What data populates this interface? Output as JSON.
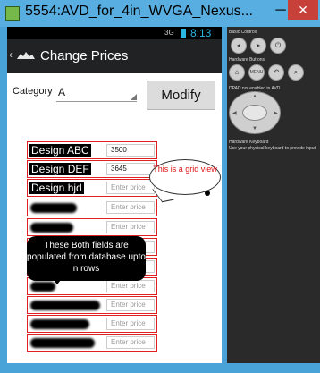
{
  "window": {
    "title": "5554:AVD_for_4in_WVGA_Nexus...",
    "minimize": "─",
    "close": "✕"
  },
  "statusbar": {
    "signal": "3G",
    "time": "8:13"
  },
  "actionbar": {
    "back": "‹",
    "title": "Change Prices"
  },
  "form": {
    "category_label": "Category",
    "category_value": "A",
    "modify_label": "Modify"
  },
  "grid": {
    "price_placeholder": "Enter price",
    "rows": [
      {
        "name": "Design ABC",
        "price": "3500"
      },
      {
        "name": "Design DEF",
        "price": "3645"
      },
      {
        "name": "Design hjd",
        "price": ""
      },
      {
        "name": "",
        "price": ""
      },
      {
        "name": "",
        "price": ""
      },
      {
        "name": "",
        "price": ""
      },
      {
        "name": "",
        "price": ""
      },
      {
        "name": "",
        "price": ""
      },
      {
        "name": "",
        "price": ""
      },
      {
        "name": "",
        "price": ""
      },
      {
        "name": "",
        "price": ""
      }
    ]
  },
  "annotations": {
    "grid_view_note": "This is a grid view",
    "database_note": "These Both fields are populated from database upto n rows"
  },
  "emulator_controls": {
    "basic_controls_label": "Basic Controls",
    "hardware_buttons_label": "Hardware Buttons",
    "dpad_label": "DPAD not enabled in AVD",
    "keyboard_label": "Hardware Keyboard",
    "keyboard_hint": "Use your physical keyboard to provide input",
    "menu_label": "MENU"
  },
  "colors": {
    "accent": "#29b6e3",
    "grid_border": "#e02020",
    "window_chrome": "#58aee0"
  }
}
